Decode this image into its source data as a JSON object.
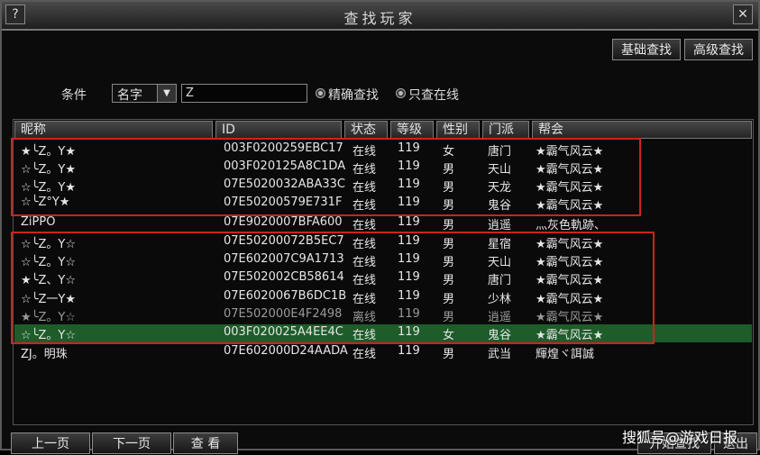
{
  "window": {
    "title": "查找玩家",
    "help": "?",
    "close": "✕"
  },
  "top_buttons": {
    "basic_search": "基础查找",
    "advanced_search": "高级查找"
  },
  "search": {
    "condition_label": "条件",
    "field_select": "名字",
    "input_value": "Z",
    "option_exact": "精确查找",
    "option_online": "只查在线"
  },
  "columns": [
    "昵称",
    "ID",
    "状态",
    "等级",
    "性别",
    "门派",
    "帮会"
  ],
  "rows": [
    [
      "★╰Z。Y★",
      "003F0200259EBC17",
      "在线",
      "119",
      "女",
      "唐门",
      "★霸气风云★"
    ],
    [
      "☆╰Z。Y★",
      "003F020125A8C1DA",
      "在线",
      "119",
      "男",
      "天山",
      "★霸气风云★"
    ],
    [
      "☆╰Z。Y★",
      "07E5020032ABA33C",
      "在线",
      "119",
      "男",
      "天龙",
      "★霸气风云★"
    ],
    [
      "☆╰Z°Y★",
      "07E50200579E731F",
      "在线",
      "119",
      "男",
      "鬼谷",
      "★霸气风云★"
    ],
    [
      "ZiPPO",
      "07E9020007BFA600",
      "在线",
      "119",
      "男",
      "逍遥",
      "灬灰色軌跡、"
    ],
    [
      "☆╰Z。Y☆",
      "07E50200072B5EC7",
      "在线",
      "119",
      "男",
      "星宿",
      "★霸气风云★"
    ],
    [
      "☆╰Z。Y☆",
      "07E602007C9A1713",
      "在线",
      "119",
      "男",
      "天山",
      "★霸气风云★"
    ],
    [
      "★╰Z、Y☆",
      "07E502002CB58614",
      "在线",
      "119",
      "男",
      "唐门",
      "★霸气风云★"
    ],
    [
      "☆╰Z一Y★",
      "07E6020067B6DC1B",
      "在线",
      "119",
      "男",
      "少林",
      "★霸气风云★"
    ],
    [
      "★╰Z。Y☆",
      "07E502000E4F2498",
      "离线",
      "119",
      "男",
      "逍遥",
      "★霸气风云★"
    ],
    [
      "☆╰Z。Y☆",
      "003F020025A4EE4C",
      "在线",
      "119",
      "女",
      "鬼谷",
      "★霸气风云★"
    ],
    [
      "ZJ。明珠",
      "07E602000D24AADA",
      "在线",
      "119",
      "男",
      "武当",
      "輝煌ヾ誀誠"
    ]
  ],
  "bottom_buttons": {
    "prev": "上一页",
    "next": "下一页",
    "view": "查 看",
    "start": "开始查找",
    "exit": "退出"
  },
  "watermark": "搜狐号@游戏日报",
  "colors": {
    "highlight_row": "#1e5c2a",
    "annotation_box": "#d02020"
  }
}
